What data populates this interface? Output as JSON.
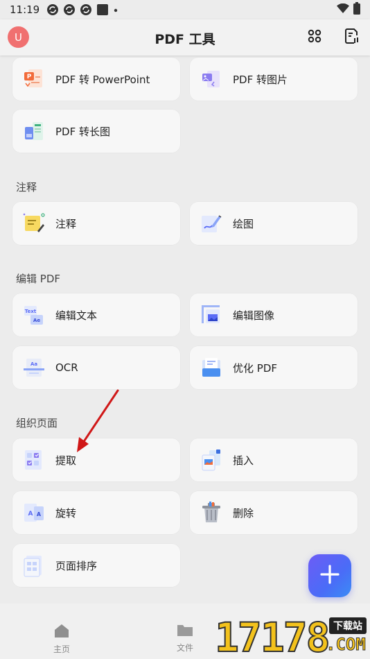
{
  "status_bar": {
    "time": "11:19"
  },
  "header": {
    "avatar_letter": "U",
    "title": "PDF 工具"
  },
  "convert": {
    "items": [
      {
        "label": "PDF 转 PowerPoint",
        "icon": "ppt-convert-icon"
      },
      {
        "label": "PDF 转图片",
        "icon": "image-convert-icon"
      },
      {
        "label": "PDF 转长图",
        "icon": "long-image-icon"
      }
    ]
  },
  "annotate": {
    "title": "注释",
    "items": [
      {
        "label": "注释",
        "icon": "sticky-note-icon"
      },
      {
        "label": "绘图",
        "icon": "drawing-icon"
      }
    ]
  },
  "edit": {
    "title": "编辑 PDF",
    "items": [
      {
        "label": "编辑文本",
        "icon": "edit-text-icon"
      },
      {
        "label": "编辑图像",
        "icon": "edit-image-icon"
      },
      {
        "label": "OCR",
        "icon": "ocr-icon"
      },
      {
        "label": "优化 PDF",
        "icon": "optimize-icon"
      }
    ]
  },
  "organize": {
    "title": "组织页面",
    "items": [
      {
        "label": "提取",
        "icon": "extract-icon"
      },
      {
        "label": "插入",
        "icon": "insert-icon"
      },
      {
        "label": "旋转",
        "icon": "rotate-icon"
      },
      {
        "label": "删除",
        "icon": "trash-icon"
      },
      {
        "label": "页面排序",
        "icon": "page-order-icon"
      }
    ]
  },
  "bottom_nav": {
    "home": "主页",
    "files": "文件"
  },
  "watermark": {
    "digits": "17178",
    "badge": "下载站",
    "com": ".COM"
  },
  "colors": {
    "accent": "#5b6cf6",
    "avatar": "#f07070",
    "arrow": "#d01818"
  }
}
